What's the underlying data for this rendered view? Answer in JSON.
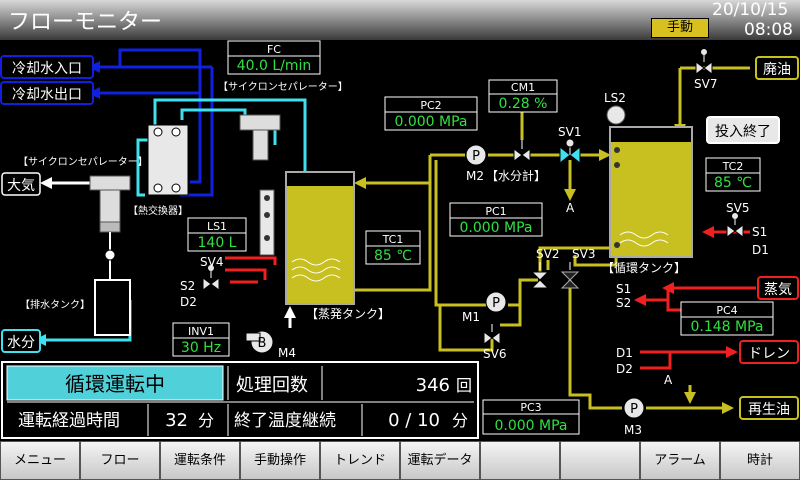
{
  "header": {
    "title": "フローモニター",
    "mode": "手動",
    "date": "20/10/15",
    "time": "08:08"
  },
  "labels": {
    "cooling_in": "冷却水入口",
    "cooling_out": "冷却水出口",
    "atmosphere": "大気",
    "water": "水分",
    "cyclone1": "【サイクロンセパレーター】",
    "cyclone2": "【サイクロンセパレーター】",
    "heat_exchanger": "【熱交換器】",
    "drain_tank": "【排水タンク】",
    "evap_tank": "【蒸発タンク】",
    "circ_tank": "【循環タンク】",
    "water_meter": "【水分計】",
    "waste_oil": "廃油",
    "input_end": "投入終了",
    "steam": "蒸気",
    "drain": "ドレン",
    "recycled_oil": "再生油"
  },
  "instruments": {
    "fc": {
      "tag": "FC",
      "value": "40.0 L/min"
    },
    "pc2": {
      "tag": "PC2",
      "value": "0.000 MPa"
    },
    "cm1": {
      "tag": "CM1",
      "value": "0.28 %"
    },
    "pc1": {
      "tag": "PC1",
      "value": "0.000 MPa"
    },
    "ls1": {
      "tag": "LS1",
      "value": "140 L"
    },
    "tc1": {
      "tag": "TC1",
      "value": "85 ℃"
    },
    "tc2": {
      "tag": "TC2",
      "value": "85 ℃"
    },
    "pc4": {
      "tag": "PC4",
      "value": "0.148 MPa"
    },
    "pc3": {
      "tag": "PC3",
      "value": "0.000 MPa"
    },
    "inv1": {
      "tag": "INV1",
      "value": "30 Hz"
    }
  },
  "tags": {
    "sv1": "SV1",
    "sv2": "SV2",
    "sv3": "SV3",
    "sv4": "SV4",
    "sv5": "SV5",
    "sv6": "SV6",
    "sv7": "SV7",
    "m1": "M1",
    "m2": "M2",
    "m3": "M3",
    "m4": "M4",
    "ls2": "LS2",
    "p": "P",
    "b": "B",
    "a1": "A",
    "a2": "A",
    "s1_sv5": "S1",
    "d1_sv5": "D1",
    "s1_steam": "S1",
    "s2_steam": "S2",
    "d1_drain": "D1",
    "d2_drain": "D2",
    "s2_sv4": "S2",
    "d2_sv4": "D2"
  },
  "status": {
    "state": "循環運転中",
    "count_label": "処理回数",
    "count_value": "346",
    "count_unit": "回",
    "elapsed_label": "運転経過時間",
    "elapsed_value": "32",
    "elapsed_unit": "分",
    "temp_label": "終了温度継続",
    "temp_value": "0 / 10",
    "temp_unit": "分"
  },
  "nav": [
    "メニュー",
    "フロー",
    "運転条件",
    "手動操作",
    "トレンド",
    "運転データ",
    "",
    "",
    "アラーム",
    "時計"
  ],
  "colors": {
    "oil": "#c8c020",
    "cooling": "#1020e0",
    "cyan": "#40e0f0",
    "red": "#f02020",
    "value": "#30e040",
    "mode": "#d8c020",
    "state_bg": "#50d0d8"
  }
}
